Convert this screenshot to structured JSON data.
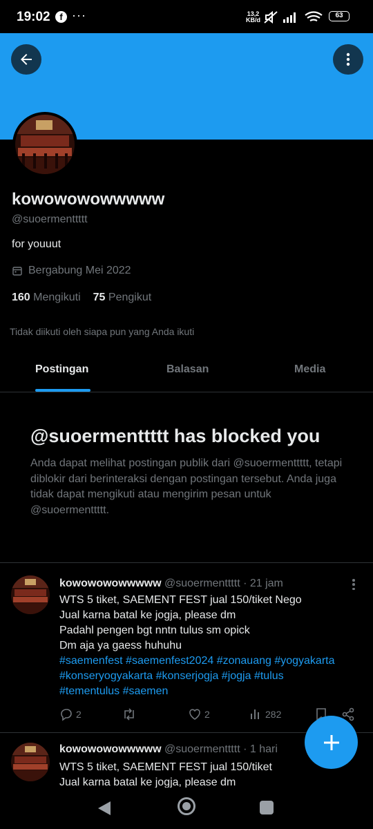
{
  "status_bar": {
    "time": "19:02",
    "dots": "···",
    "speed_value": "13,2",
    "speed_unit": "KB/d",
    "battery": "63"
  },
  "profile": {
    "name": "kowowowowwwww",
    "handle": "@suoermenttttt",
    "bio": "for youuut",
    "joined": "Bergabung Mei 2022",
    "following_count": "160",
    "following_label": "Mengikuti",
    "followers_count": "75",
    "followers_label": "Pengikut",
    "not_followed_note": "Tidak diikuti oleh siapa pun yang Anda ikuti"
  },
  "tabs": [
    {
      "label": "Postingan",
      "active": true
    },
    {
      "label": "Balasan",
      "active": false
    },
    {
      "label": "Media",
      "active": false
    }
  ],
  "blocked": {
    "title": "@suoermenttttt has blocked you",
    "description": "Anda dapat melihat postingan publik dari @suoermenttttt, tetapi diblokir dari berinteraksi dengan postingan tersebut. Anda juga tidak dapat mengikuti atau mengirim pesan untuk @suoermenttttt."
  },
  "tweets": [
    {
      "name": "kowowowowwwww",
      "handle_time": "@suoermenttttt · 21 jam",
      "lines": [
        "WTS 5 tiket, SAEMENT FEST jual 150/tiket Nego",
        "Jual karna batal ke jogja, please dm",
        "Padahl pengen bgt nntn tulus sm opick",
        "Dm aja ya gaess huhuhu"
      ],
      "tags": [
        "#saemenfest #saemenfest2024 #zonauang #yogyakarta",
        "#konseryogyakarta #konserjogja #jogja #tulus",
        "#tementulus #saemen"
      ],
      "replies": "2",
      "likes": "2",
      "views": "282"
    },
    {
      "name": "kowowowowwwww",
      "handle_time": "@suoermenttttt · 1 hari",
      "lines": [
        "WTS 5 tiket, SAEMENT FEST jual 150/tiket",
        "Jual karna batal ke jogja, please dm"
      ]
    }
  ],
  "colors": {
    "accent": "#1d9bf0",
    "background": "#000000",
    "text_primary": "#e7e9ea",
    "text_secondary": "#71767b",
    "border": "#2f3336"
  },
  "icons": [
    "back-arrow-icon",
    "more-vertical-icon",
    "calendar-icon",
    "reply-icon",
    "retweet-icon",
    "like-icon",
    "views-icon",
    "bookmark-icon",
    "share-icon",
    "plus-icon"
  ]
}
